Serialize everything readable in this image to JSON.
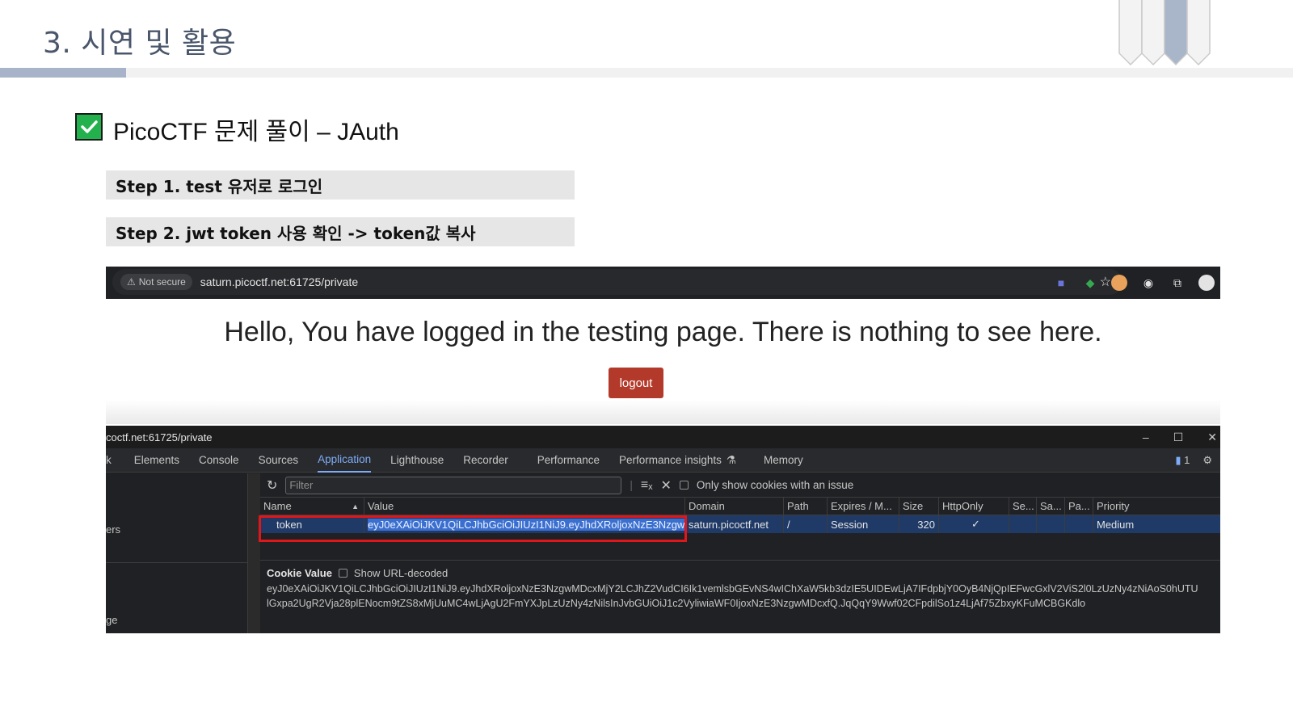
{
  "slide": {
    "title": "3. 시연 및 활용",
    "heading": "PicoCTF 문제 풀이 – JAuth",
    "steps": [
      "Step 1. test 유저로 로그인",
      "Step 2. jwt token 사용 확인 -> token값 복사"
    ]
  },
  "browser": {
    "security_badge": "Not secure",
    "url": "saturn.picoctf.net:61725/private",
    "page_message": "Hello, You have logged in the testing page. There is nothing to see here.",
    "logout_label": "logout"
  },
  "devtools": {
    "window_title": "coctf.net:61725/private",
    "tabs": [
      "k",
      "Elements",
      "Console",
      "Sources",
      "Application",
      "Lighthouse",
      "Recorder",
      "Performance",
      "Performance insights",
      "Memory"
    ],
    "active_tab": "Application",
    "issues_count": "1",
    "filter_placeholder": "Filter",
    "only_issues_label": "Only show cookies with an issue",
    "left_items": [
      "ers",
      "ge"
    ],
    "columns": [
      "Name",
      "Value",
      "Domain",
      "Path",
      "Expires / M...",
      "Size",
      "HttpOnly",
      "Se...",
      "Sa...",
      "Pa...",
      "Priority"
    ],
    "cookie_row": {
      "name": "token",
      "value": "eyJ0eXAiOiJKV1QiLCJhbGciOiJIUzI1NiJ9.eyJhdXRoljoxNzE3NzgwMD",
      "domain": "saturn.picoctf.net",
      "path": "/",
      "expires": "Session",
      "size": "320",
      "httponly": "✓",
      "priority": "Medium"
    },
    "cookie_value_label": "Cookie Value",
    "url_decoded_label": "Show URL-decoded",
    "cookie_value_lines": [
      "eyJ0eXAiOiJKV1QiLCJhbGciOiJIUzI1NiJ9.eyJhdXRoljoxNzE3NzgwMDcxMjY2LCJhZ2VudCI6Ik1vemlsbGEvNS4wIChXaW5kb3dzIE5UIDEwLjA7IFdpbjY0OyB4NjQpIEFwcGxlV2ViS2l0LzUzNy4zNiAoS0hUTU",
      "lGxpa2UgR2Vja28plENocm9tZS8xMjUuMC4wLjAgU2FmYXJpLzUzNy4zNilsInJvbGUiOiJ1c2VyliwiaWF0IjoxNzE3NzgwMDcxfQ.JqQqY9Wwf02CFpdilSo1z4LjAf75ZbxyKFuMCBGKdlo"
    ]
  },
  "colors": {
    "title_color": "#4a566b",
    "accent_bar": "#a7b3c8",
    "check_green": "#22b14c",
    "logout_red": "#b33a2a",
    "highlight_red": "#e0161a",
    "devtools_bg": "#202124",
    "devtools_accent": "#7cacf8"
  }
}
